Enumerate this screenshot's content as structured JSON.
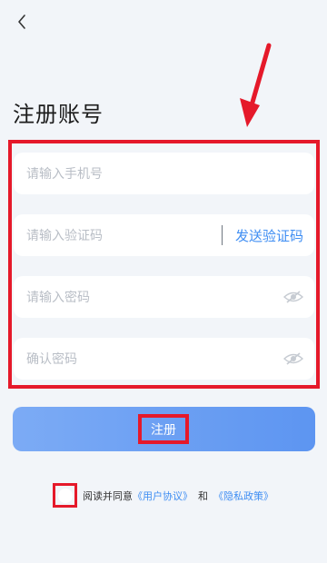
{
  "header": {
    "back_icon": "chevron-left-icon"
  },
  "page": {
    "title": "注册账号"
  },
  "form": {
    "phone_placeholder": "请输入手机号",
    "code_placeholder": "请输入验证码",
    "send_code_label": "发送验证码",
    "password_placeholder": "请输入密码",
    "confirm_placeholder": "确认密码",
    "eye_icon": "eye-closed-icon"
  },
  "submit": {
    "label": "注册"
  },
  "agreement": {
    "prefix": "阅读并同意",
    "user_agreement": "《用户协议》",
    "and": "和",
    "privacy_policy": "《隐私政策》"
  },
  "colors": {
    "accent": "#3f8ef3",
    "highlight": "#e5192a",
    "background": "#f2f5f9"
  }
}
